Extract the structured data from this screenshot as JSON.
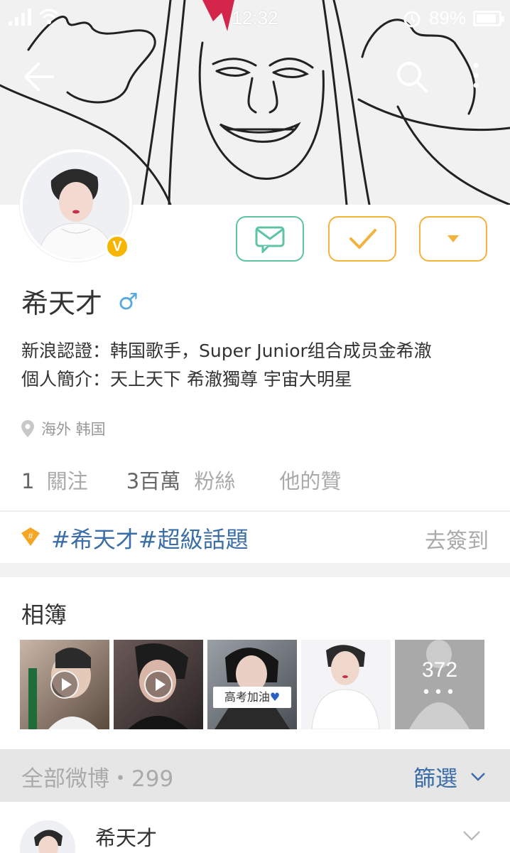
{
  "status_bar": {
    "time": "12:32",
    "battery": "89%",
    "battery_level": 0.89
  },
  "header": {
    "back_icon": "back-arrow-icon",
    "search_icon": "search-icon",
    "more_icon": "more-vertical-icon"
  },
  "profile": {
    "name": "希天才",
    "gender_symbol": "♂",
    "verified_badge": "V",
    "verification": "新浪認證：韩国歌手，Super Junior组合成员金希澈",
    "bio": "個人簡介：天上天下 希澈獨尊 宇宙大明星",
    "location": "海外 韩国",
    "buttons": {
      "message_icon": "message-icon",
      "follow_icon": "check-icon",
      "dropdown_icon": "caret-down-icon"
    },
    "stats": {
      "following_count": "1",
      "following_label": "關注",
      "followers_count": "3百萬",
      "followers_label": "粉絲",
      "likes_label": "他的贊"
    }
  },
  "topic": {
    "text": "#希天才#超級話題",
    "action": "去簽到"
  },
  "album": {
    "title": "相簿",
    "photo3_caption": "高考加油",
    "more_count": "372",
    "more_dots": "•••"
  },
  "feed": {
    "title": "全部微博・299",
    "filter": "篩選",
    "first_post_author": "希天才"
  },
  "colors": {
    "accent_blue": "#3b6ea8",
    "follow_orange": "#f3b33d",
    "message_green": "#5fc4a6",
    "verified_gold": "#f7b500"
  }
}
